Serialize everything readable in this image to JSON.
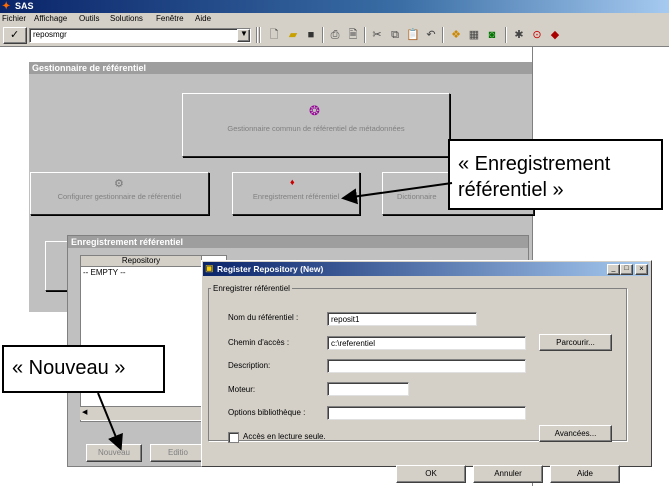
{
  "app": {
    "title": "SAS"
  },
  "menu": [
    "Fichier",
    "Affichage",
    "Outils",
    "Solutions",
    "Fenêtre",
    "Aide"
  ],
  "toolbar": {
    "combo_value": "reposmgr"
  },
  "manager": {
    "title": "Gestionnaire de référentiel",
    "common_button": "Gestionnaire commun de référentiel de métadonnées",
    "configure_button": "Configurer gestionnaire de référentiel",
    "register_button": "Enregistrement référentiel",
    "dictionary_button": "Dictionnaire"
  },
  "registration": {
    "title": "Enregistrement référentiel",
    "column_repository": "Repository",
    "empty_row": "-- EMPTY --",
    "new_button": "Nouveau",
    "edit_button": "Editio"
  },
  "dialog": {
    "title": "Register Repository (New)",
    "group_label": "Enregistrer référentiel",
    "name_label": "Nom du référentiel :",
    "name_value": "reposit1",
    "path_label": "Chemin d'accès :",
    "path_value": "c:\\referentiel",
    "browse_button": "Parcourir...",
    "description_label": "Description:",
    "engine_label": "Moteur:",
    "options_label": "Options bibliothèque :",
    "readonly_label": "Accès en lecture seule.",
    "advanced_button": "Avancées...",
    "ok_button": "OK",
    "cancel_button": "Annuler",
    "help_button": "Aide"
  },
  "callouts": {
    "register": "« Enregistrement référentiel »",
    "new": "« Nouveau »"
  }
}
